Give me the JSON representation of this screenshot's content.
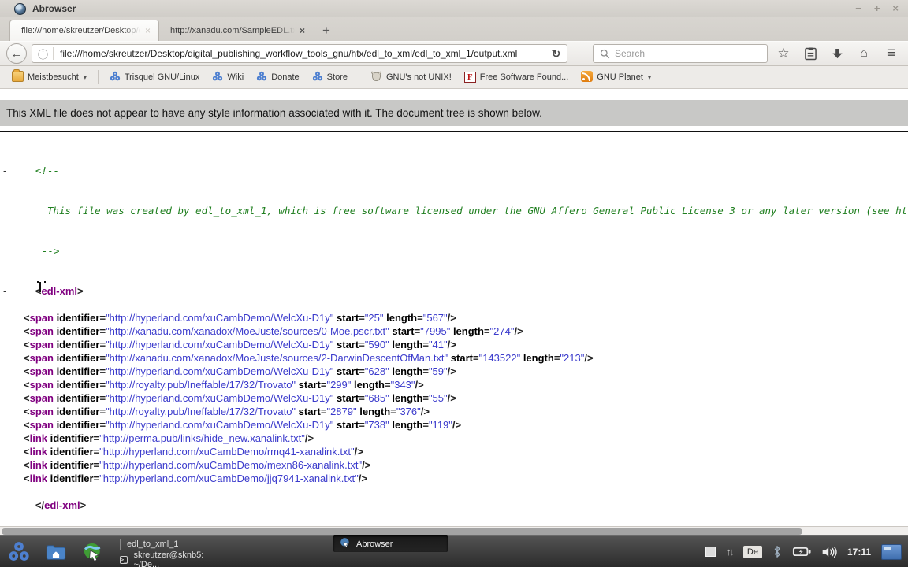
{
  "window": {
    "title": "Abrowser",
    "controls": {
      "minimize": "−",
      "maximize": "+",
      "close": "×"
    }
  },
  "glyphs": {
    "close": "×",
    "plus": "+",
    "back": "←",
    "reload": "↻",
    "info": "ⓘ",
    "star": "☆",
    "home": "⌂",
    "menu": "≡",
    "dropdown": "▾",
    "collapse": "-",
    "up_arrow": "↑",
    "down_arrow": "↓",
    "terminal": ">_"
  },
  "tabs": [
    {
      "label": "file:///home/skreutzer/Desktop/digi",
      "active": true
    },
    {
      "label": "http://xanadu.com/SampleEDL.txt",
      "active": false
    }
  ],
  "navbar": {
    "url": "file:///home/skreutzer/Desktop/digital_publishing_workflow_tools_gnu/htx/edl_to_xml/edl_to_xml_1/output.xml",
    "search_placeholder": "Search"
  },
  "bookmarks": [
    {
      "type": "item",
      "icon": "folder-icon",
      "label": "Meistbesucht",
      "dropdown": true
    },
    {
      "type": "separator"
    },
    {
      "type": "item",
      "icon": "trisquel-icon",
      "label": "Trisquel GNU/Linux"
    },
    {
      "type": "item",
      "icon": "trisquel-icon",
      "label": "Wiki"
    },
    {
      "type": "item",
      "icon": "trisquel-icon",
      "label": "Donate"
    },
    {
      "type": "item",
      "icon": "trisquel-icon",
      "label": "Store"
    },
    {
      "type": "separator"
    },
    {
      "type": "item",
      "icon": "gnu-icon",
      "label": "GNU's not UNIX!"
    },
    {
      "type": "item",
      "icon": "fsf-icon",
      "label": "Free Software Found..."
    },
    {
      "type": "item",
      "icon": "rss-icon",
      "label": "GNU Planet",
      "dropdown": true
    }
  ],
  "notice": "This XML file does not appear to have any style information associated with it. The document tree is shown below.",
  "xml": {
    "comment_open": "<!--",
    "comment_text": "This file was created by edl_to_xml_1, which is free software licensed under the GNU Affero General Public License 3 or any later version (see https://github.com/publishing-systems/digital_publishing_workflow_tools/).",
    "comment_close": "-->",
    "root_tag": "edl-xml",
    "spans": [
      {
        "identifier": "http://hyperland.com/xuCambDemo/WelcXu-D1y",
        "start": "25",
        "length": "567"
      },
      {
        "identifier": "http://xanadu.com/xanadox/MoeJuste/sources/0-Moe.pscr.txt",
        "start": "7995",
        "length": "274"
      },
      {
        "identifier": "http://hyperland.com/xuCambDemo/WelcXu-D1y",
        "start": "590",
        "length": "41"
      },
      {
        "identifier": "http://xanadu.com/xanadox/MoeJuste/sources/2-DarwinDescentOfMan.txt",
        "start": "143522",
        "length": "213"
      },
      {
        "identifier": "http://hyperland.com/xuCambDemo/WelcXu-D1y",
        "start": "628",
        "length": "59"
      },
      {
        "identifier": "http://royalty.pub/Ineffable/17/32/Trovato",
        "start": "299",
        "length": "343"
      },
      {
        "identifier": "http://hyperland.com/xuCambDemo/WelcXu-D1y",
        "start": "685",
        "length": "55"
      },
      {
        "identifier": "http://royalty.pub/Ineffable/17/32/Trovato",
        "start": "2879",
        "length": "376"
      },
      {
        "identifier": "http://hyperland.com/xuCambDemo/WelcXu-D1y",
        "start": "738",
        "length": "119"
      }
    ],
    "links": [
      {
        "identifier": "http://perma.pub/links/hide_new.xanalink.txt"
      },
      {
        "identifier": "http://hyperland.com/xuCambDemo/rmq41-xanalink.txt"
      },
      {
        "identifier": "http://hyperland.com/xuCambDemo/mexn86-xanalink.txt"
      },
      {
        "identifier": "http://hyperland.com/xuCambDemo/jjq7941-xanalink.txt"
      }
    ]
  },
  "taskbar": {
    "tasks": [
      {
        "label": "edl_to_xml_1",
        "icon": "window",
        "active": false
      },
      {
        "label": "Abrowser",
        "icon": "browser",
        "active": true
      },
      {
        "label": "skreutzer@sknb5: ~/De...",
        "icon": "terminal",
        "active": false
      }
    ],
    "keyboard_layout": "De",
    "clock": "17:11"
  }
}
